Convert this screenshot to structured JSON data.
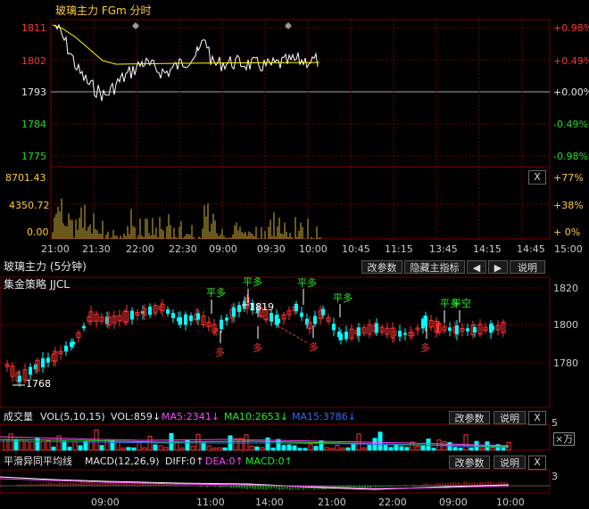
{
  "top_chart": {
    "title": "玻璃主力 FGm 分时",
    "y_left_labels": [
      "1811",
      "1802",
      "1793",
      "1784",
      "1775"
    ],
    "y_right_labels": [
      "+0.98%",
      "+0.49%",
      "+0.00%",
      "-0.49%",
      "-0.98%"
    ],
    "vol_left_labels": [
      "8701.43",
      "4350.72",
      "0.00"
    ],
    "vol_right_labels": [
      "+77%",
      "+38%",
      "+ 0%"
    ],
    "close_label": "X",
    "time_labels": [
      "21:00",
      "21:30",
      "22:00",
      "22:30",
      "09:00",
      "09:30",
      "10:00",
      "10:45",
      "11:15",
      "13:45",
      "14:15",
      "14:45",
      "15:00"
    ]
  },
  "kline_panel": {
    "title": "玻璃主力 (5分钟)",
    "buttons": {
      "modify": "改参数",
      "hide_indicator": "隐藏主指标",
      "left": "◀",
      "right": "▶",
      "help": "说明"
    },
    "strategy_label": "集金策略 JJCL",
    "y_labels": [
      "1820",
      "1800",
      "1780"
    ],
    "annotations": {
      "high": "1819",
      "low": "1768"
    },
    "signals": {
      "flat": "平多",
      "flat_short": "平空",
      "long": "多"
    }
  },
  "volume_panel": {
    "name": "成交量",
    "formula": "VOL(5,10,15)",
    "vol": "VOL:859↓",
    "ma5": "MA5:2341↓",
    "ma10": "MA10:2653↓",
    "ma15": "MA15:3786↓",
    "modify": "改参数",
    "help": "说明",
    "close": "X",
    "scale": "5",
    "unit": "×万"
  },
  "macd_panel": {
    "name": "平滑异同平均线",
    "formula": "MACD(12,26,9)",
    "dif": "DIFF:0↑",
    "dea": "DEA:0↑",
    "macd": "MACD:0↑",
    "modify": "改参数",
    "help": "说明",
    "close": "X",
    "scale": "3"
  },
  "bottom_axis": [
    "09:00",
    "11:00",
    "14:00",
    "21:00",
    "22:00",
    "09:00",
    "10:00"
  ],
  "colors": {
    "up": "#ff3333",
    "down": "#00ffff",
    "grid": "#7a0000",
    "price": "#ffffff",
    "avg": "#ffff00",
    "vol_bar": "#d4b23a"
  }
}
